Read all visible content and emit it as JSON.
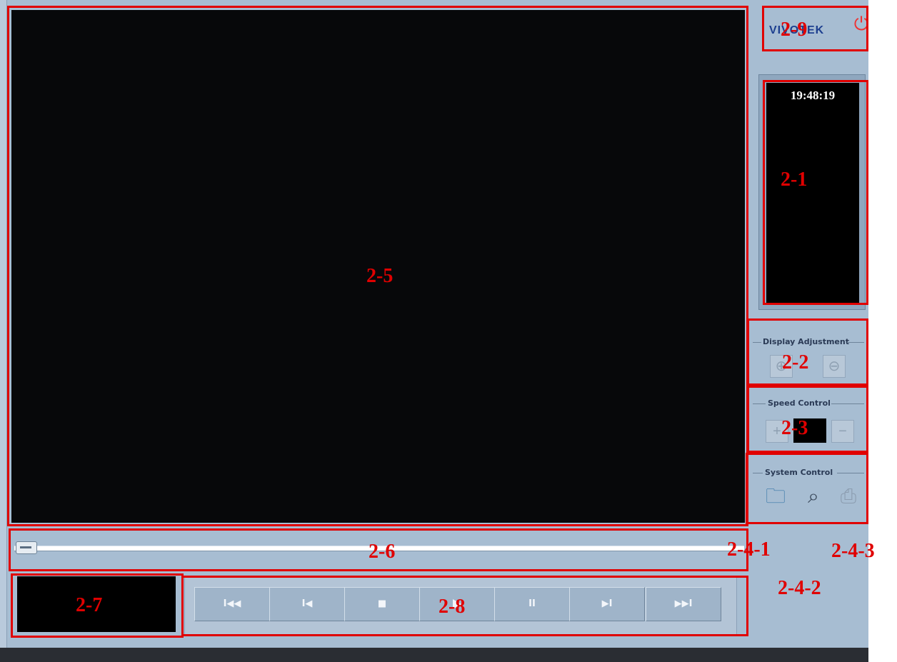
{
  "window": {
    "brand_logo": "VIVOTEK",
    "power_icon": "power-icon"
  },
  "clock": {
    "time": "19:48:19"
  },
  "display_adjustment": {
    "title": "Display Adjustment",
    "icons": [
      "zoom-in-icon",
      "zoom-out-icon"
    ]
  },
  "speed_control": {
    "title": "Speed Control",
    "plus": "+",
    "minus": "−"
  },
  "system_control": {
    "title": "System Control",
    "icons": [
      "folder-icon",
      "search-icon",
      "print-icon"
    ]
  },
  "transport": {
    "buttons": [
      {
        "name": "first",
        "label": "I◀◀"
      },
      {
        "name": "previous",
        "label": "I◀"
      },
      {
        "name": "stop",
        "label": "■"
      },
      {
        "name": "play",
        "label": ""
      },
      {
        "name": "pause",
        "label": "II"
      },
      {
        "name": "next",
        "label": "▶I"
      },
      {
        "name": "last",
        "label": "▶▶I"
      }
    ]
  },
  "timeline": {
    "position_fraction": 0.0
  },
  "annotations": {
    "a_2_9": "2-9",
    "a_2_1": "2-1",
    "a_2_5": "2-5",
    "a_2_2": "2-2",
    "a_2_3": "2-3",
    "a_2_6": "2-6",
    "a_2_4_1": "2-4-1",
    "a_2_4_3": "2-4-3",
    "a_2_4_2": "2-4-2",
    "a_2_7": "2-7",
    "a_2_8": "2-8"
  },
  "colors": {
    "annotation_red": "#e00000",
    "panel_blue": "#a7bdd2",
    "video_black": "#07080a"
  }
}
